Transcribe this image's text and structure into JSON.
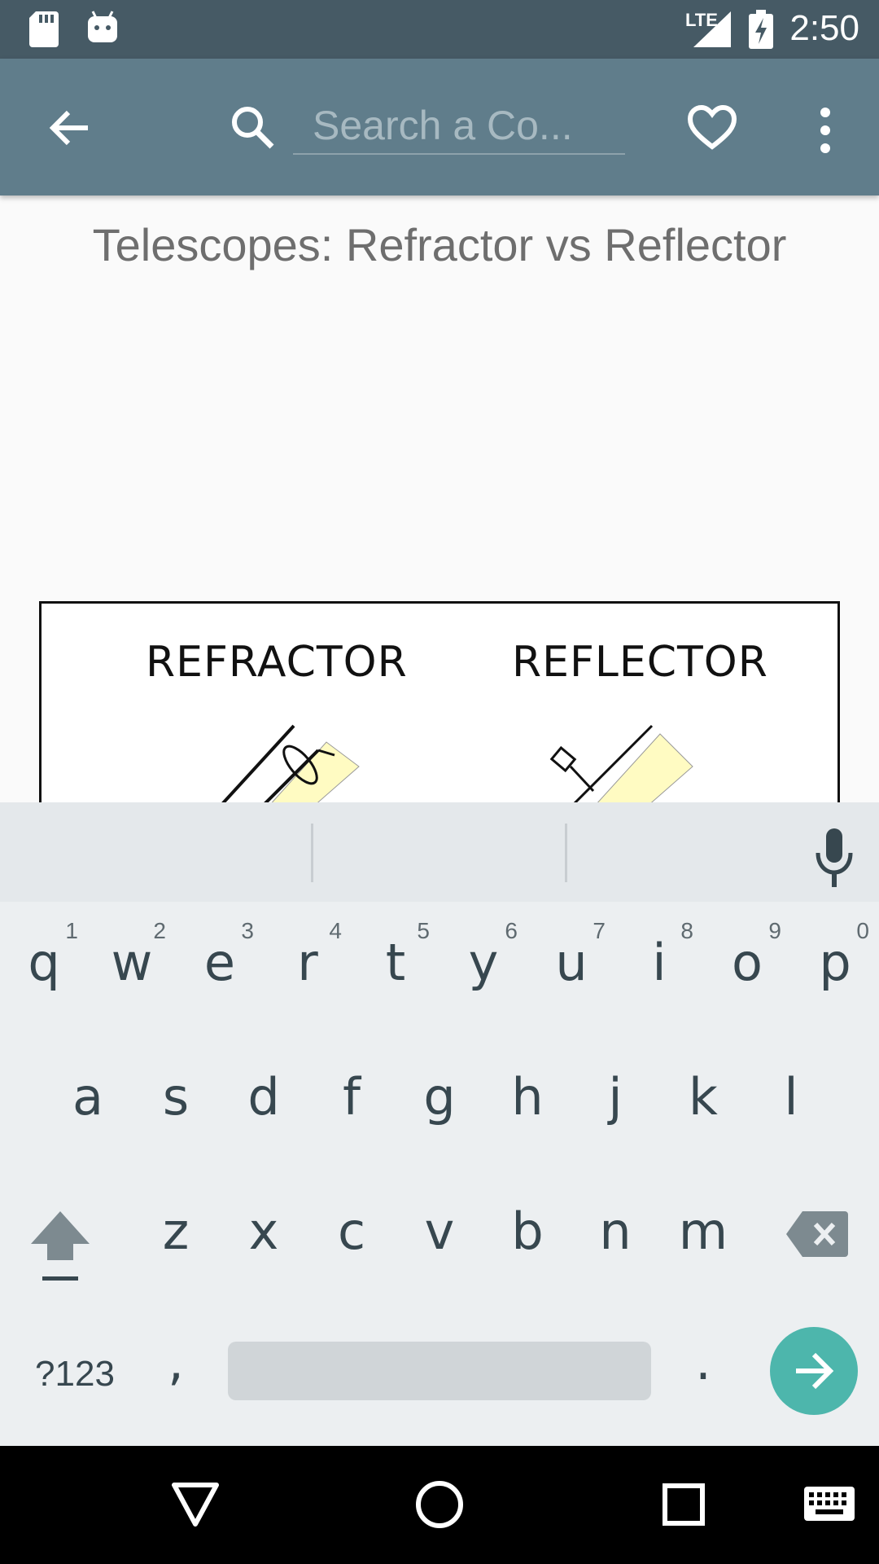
{
  "status_bar": {
    "time": "2:50",
    "network_label": "LTE",
    "icons": [
      "sd-card-icon",
      "android-icon",
      "lte-signal-icon",
      "battery-charging-icon"
    ]
  },
  "toolbar": {
    "search_placeholder": "Search a Co...",
    "icons": [
      "back-arrow-icon",
      "search-icon",
      "heart-icon",
      "more-vert-icon"
    ]
  },
  "comic": {
    "title": "Telescopes: Refractor vs Reflector",
    "panel_labels": [
      "REFRACTOR",
      "REFLECTOR"
    ]
  },
  "keyboard": {
    "row1": [
      {
        "key": "q",
        "hint": "1"
      },
      {
        "key": "w",
        "hint": "2"
      },
      {
        "key": "e",
        "hint": "3"
      },
      {
        "key": "r",
        "hint": "4"
      },
      {
        "key": "t",
        "hint": "5"
      },
      {
        "key": "y",
        "hint": "6"
      },
      {
        "key": "u",
        "hint": "7"
      },
      {
        "key": "i",
        "hint": "8"
      },
      {
        "key": "o",
        "hint": "9"
      },
      {
        "key": "p",
        "hint": "0"
      }
    ],
    "row2": [
      "a",
      "s",
      "d",
      "f",
      "g",
      "h",
      "j",
      "k",
      "l"
    ],
    "row3": [
      "z",
      "x",
      "c",
      "v",
      "b",
      "n",
      "m"
    ],
    "symbols_label": "?123",
    "comma": ",",
    "period": ".",
    "colors": {
      "enter": "#4db6ac",
      "background": "#eceff1"
    }
  },
  "nav_bar": {
    "icons": [
      "back-triangle-icon",
      "home-circle-icon",
      "recents-square-icon",
      "keyboard-icon"
    ]
  }
}
